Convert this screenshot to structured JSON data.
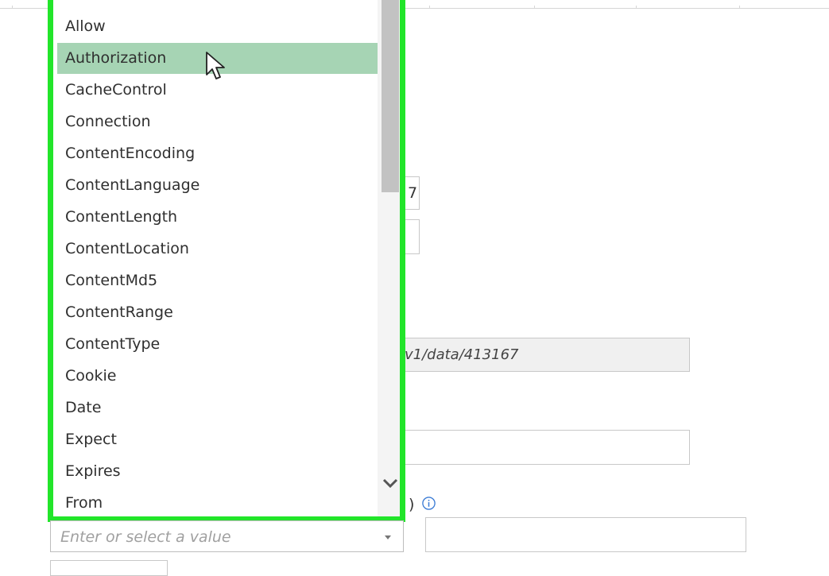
{
  "dropdown": {
    "options": [
      "Allow",
      "Authorization",
      "CacheControl",
      "Connection",
      "ContentEncoding",
      "ContentLanguage",
      "ContentLength",
      "ContentLocation",
      "ContentMd5",
      "ContentRange",
      "ContentType",
      "Cookie",
      "Date",
      "Expect",
      "Expires",
      "From"
    ],
    "hovered_option": "Authorization"
  },
  "background": {
    "field_fragment_1": "7",
    "url_fragment": "v1/data/413167",
    "label_fragment": ")"
  },
  "header_value_combo": {
    "placeholder": "Enter or select a value"
  },
  "colors": {
    "highlight_border": "#22e52a",
    "hover_row": "#a6d4b4"
  }
}
